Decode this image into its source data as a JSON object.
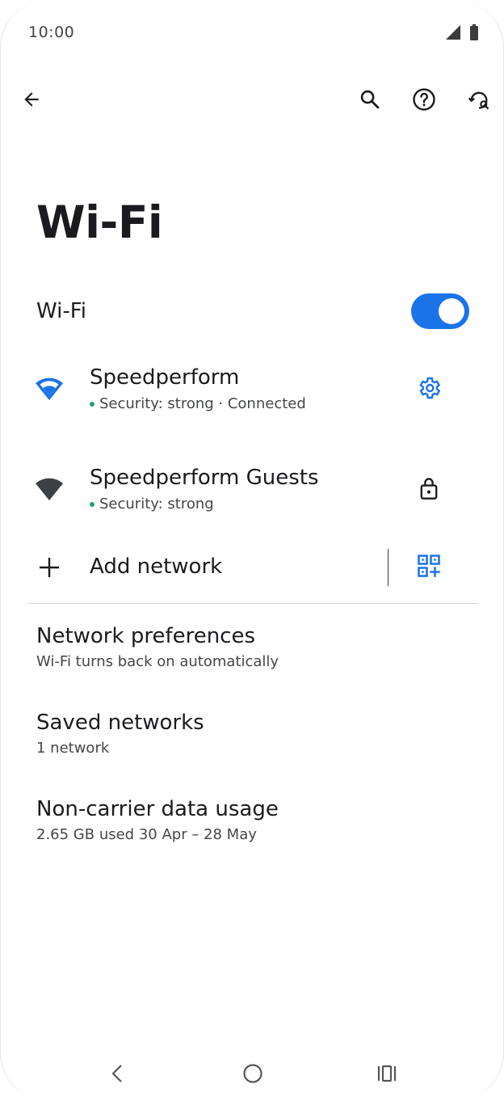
{
  "status_bar": {
    "time": "10:00",
    "icons": [
      "cellular-signal-icon",
      "battery-icon"
    ]
  },
  "app_bar": {
    "back_icon": "arrow-left-icon",
    "search_icon": "search-icon",
    "help_icon": "help-circle-icon",
    "sync_icon": "sync-settings-icon"
  },
  "page": {
    "title": "Wi-Fi"
  },
  "wifi_toggle": {
    "label": "Wi-Fi",
    "enabled": true
  },
  "networks": [
    {
      "name": "Speedperform",
      "status": "Security: strong · Connected",
      "connected": true,
      "icon": "wifi-full-icon",
      "icon_color": "#1a73e8",
      "action_icon": "gear-icon"
    },
    {
      "name": "Speedperform Guests",
      "status": "Security: strong",
      "connected": false,
      "icon": "wifi-full-icon",
      "icon_color": "#3c4043",
      "action_icon": "lock-icon"
    }
  ],
  "add_network": {
    "label": "Add network",
    "icon": "plus-icon",
    "qr_icon": "qr-code-scan-icon"
  },
  "preferences": [
    {
      "title": "Network preferences",
      "subtitle": "Wi-Fi turns back on automatically"
    },
    {
      "title": "Saved networks",
      "subtitle": "1 network"
    },
    {
      "title": "Non-carrier data usage",
      "subtitle": "2.65 GB used 30 Apr – 28 May"
    }
  ],
  "colors": {
    "accent": "#1a73e8",
    "status_dot": "#1aa37a",
    "text_primary": "#1b1b1f",
    "text_secondary": "#444746"
  },
  "nav_bar": {
    "back_icon": "nav-back-icon",
    "home_icon": "nav-home-icon",
    "recents_icon": "nav-recents-icon"
  }
}
